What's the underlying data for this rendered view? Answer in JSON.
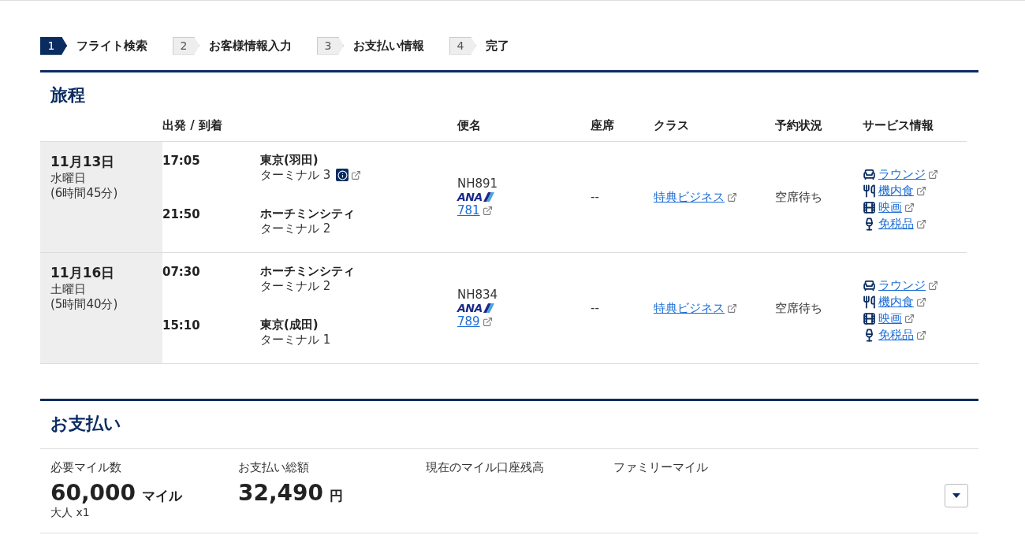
{
  "steps": [
    {
      "number": "1",
      "label": "フライト検索",
      "selected": true
    },
    {
      "number": "2",
      "label": "お客様情報入力",
      "selected": false
    },
    {
      "number": "3",
      "label": "お支払い情報",
      "selected": false
    },
    {
      "number": "4",
      "label": "完了",
      "selected": false
    }
  ],
  "itinerary": {
    "title": "旅程",
    "columns": [
      "出発 / 到着",
      "便名",
      "座席",
      "クラス",
      "予約状況",
      "サービス情報"
    ],
    "rows": [
      {
        "date": "11月13日",
        "weekday": "水曜日",
        "duration": "(6時間45分)",
        "segments": [
          {
            "time": "17:05",
            "airport": "東京(羽田)",
            "terminal": "ターミナル 3",
            "info": true
          },
          {
            "time": "21:50",
            "airport": "ホーチミンシティ",
            "terminal": "ターミナル 2",
            "info": false
          }
        ],
        "flight": "NH891",
        "logo": "ANA",
        "aircraft": "781",
        "seat": "--",
        "class": "特典ビジネス",
        "status": "空席待ち",
        "services": [
          {
            "kind": "lounge",
            "label": "ラウンジ"
          },
          {
            "kind": "meal",
            "label": "機内食"
          },
          {
            "kind": "movie",
            "label": "映画"
          },
          {
            "kind": "dutyfree",
            "label": "免税品"
          }
        ]
      },
      {
        "date": "11月16日",
        "weekday": "土曜日",
        "duration": "(5時間40分)",
        "segments": [
          {
            "time": "07:30",
            "airport": "ホーチミンシティ",
            "terminal": "ターミナル 2",
            "info": false
          },
          {
            "time": "15:10",
            "airport": "東京(成田)",
            "terminal": "ターミナル 1",
            "info": false
          }
        ],
        "flight": "NH834",
        "logo": "ANA",
        "aircraft": "789",
        "seat": "--",
        "class": "特典ビジネス",
        "status": "空席待ち",
        "services": [
          {
            "kind": "lounge",
            "label": "ラウンジ"
          },
          {
            "kind": "meal",
            "label": "機内食"
          },
          {
            "kind": "movie",
            "label": "映画"
          },
          {
            "kind": "dutyfree",
            "label": "免税品"
          }
        ]
      }
    ]
  },
  "payment": {
    "title": "お支払い",
    "items": [
      {
        "label": "必要マイル数",
        "value": "60,000",
        "unit": "マイル",
        "note": "大人 x1"
      },
      {
        "label": "お支払い総額",
        "value": "32,490",
        "unit": "円"
      },
      {
        "label": "現在のマイル口座残高"
      },
      {
        "label": "ファミリーマイル"
      }
    ]
  }
}
